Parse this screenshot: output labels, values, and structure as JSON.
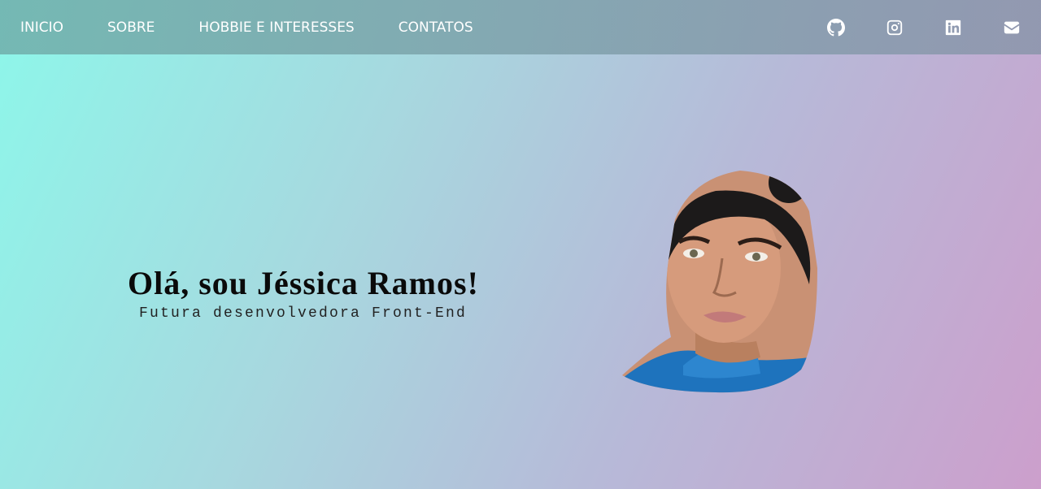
{
  "nav": {
    "links": [
      "INICIO",
      "SOBRE",
      "HOBBIE E INTERESSES",
      "CONTATOS"
    ],
    "social_icons": [
      "github-icon",
      "instagram-icon",
      "linkedin-icon",
      "email-icon"
    ]
  },
  "hero": {
    "title": "Olá, sou Jéssica Ramos!",
    "subtitle": "Futura desenvolvedora Front-End"
  },
  "colors": {
    "gradient_start": "#8df7ea",
    "gradient_end": "#cc9fcc",
    "nav_text": "#ffffff"
  }
}
